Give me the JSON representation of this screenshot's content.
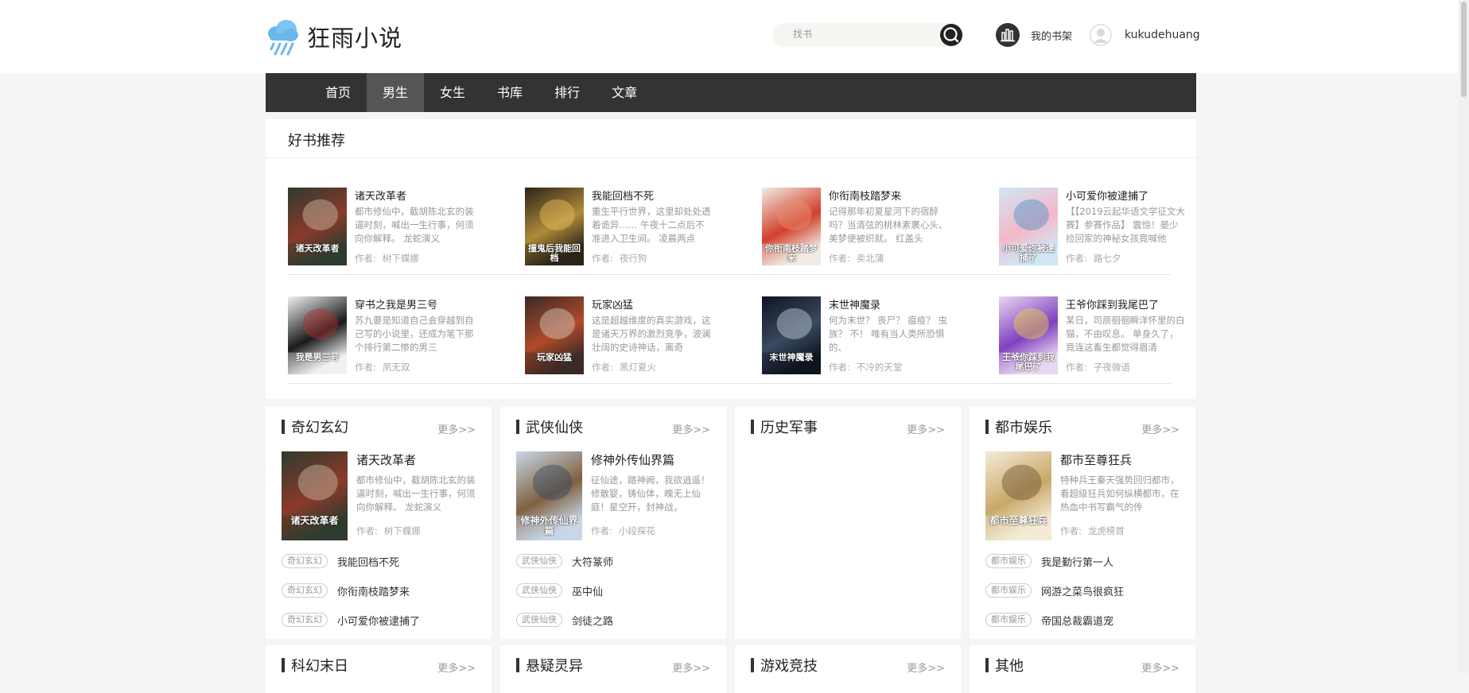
{
  "header": {
    "site_name": "狂雨小说",
    "search_placeholder": "找书",
    "shelf_label": "我的书架",
    "username": "kukudehuang"
  },
  "nav": [
    {
      "label": "首页",
      "active": false
    },
    {
      "label": "男生",
      "active": true
    },
    {
      "label": "女生",
      "active": false
    },
    {
      "label": "书库",
      "active": false
    },
    {
      "label": "排行",
      "active": false
    },
    {
      "label": "文章",
      "active": false
    }
  ],
  "recommend": {
    "title": "好书推荐",
    "author_prefix": "作者:",
    "books": [
      {
        "title": "诸天改革者",
        "desc": "都市修仙中，截胡陈北玄的装逼时刻，喊出一生行事，何须向你解释。 龙蛇演义",
        "author": "树下蝶娜",
        "colors": [
          "#2d3b2f",
          "#8a3a2a",
          "#c9c2a8"
        ]
      },
      {
        "title": "我能回档不死",
        "desc": "重生平行世界，这里却处处透着诡异…… 午夜十二点后不准进入卫生间。 凌晨两点",
        "author": "夜行狗",
        "colors": [
          "#2a2418",
          "#b08a3a",
          "#e8c060"
        ]
      },
      {
        "title": "你衔南枝踏梦来",
        "desc": "记得那年初夏星河下的宿醉吗？当清弦的桃林素裹心头、美梦便被织就。 红盖头",
        "author": "卖北蒲",
        "colors": [
          "#f2ece4",
          "#d0402a",
          "#e89070"
        ]
      },
      {
        "title": "小可爱你被逮捕了",
        "desc": "【【2019云起华语文学征文大赛】参赛作品】 震惊！晏少捡回家的神秘女孩竟喊他",
        "author": "路七夕",
        "colors": [
          "#cfe6f5",
          "#f5b8c8",
          "#4a90c8"
        ]
      },
      {
        "title": "穿书之我是男三号",
        "desc": "苏九要是知道自己会穿越到自己写的小说里，还成为笔下那个排行第二惨的男三",
        "author": "夙无双",
        "colors": [
          "#f2f2f2",
          "#1a1a1a",
          "#b03030"
        ]
      },
      {
        "title": "玩家凶猛",
        "desc": "这是超越维度的真实游戏，这是诸天万界的激烈竞争，波澜壮阔的史诗神话，离奇",
        "author": "黑灯夏火",
        "colors": [
          "#3a2a24",
          "#b04a2a",
          "#d8d0c8"
        ]
      },
      {
        "title": "末世神魔录",
        "desc": "何为末世？ 丧尸？ 瘟疫？ 虫族？ 不！ 唯有当人类所恐惧的、",
        "author": "不冷的天堂",
        "colors": [
          "#0e1420",
          "#3a4a60",
          "#c8d0e0"
        ]
      },
      {
        "title": "王爷你踩到我尾巴了",
        "desc": "某日，司辰徊徊瞬洋怀里的白猫，不由叹息。 单身久了，竟连这畜生都觉得眉清",
        "author": "子夜微语",
        "colors": [
          "#e8d8f0",
          "#8040c0",
          "#f0d040"
        ]
      }
    ]
  },
  "categories": [
    {
      "title": "奇幻玄幻",
      "more": "更多>>",
      "featured": {
        "title": "诸天改革者",
        "desc": "都市修仙中，截胡陈北玄的装逼时刻，喊出一生行事，何须向你解释。 龙蛇演义",
        "author": "树下蝶娜",
        "colors": [
          "#2d3b2f",
          "#8a3a2a",
          "#c9c2a8"
        ]
      },
      "items": [
        {
          "tag": "奇幻玄幻",
          "title": "我能回档不死"
        },
        {
          "tag": "奇幻玄幻",
          "title": "你衔南枝踏梦来"
        },
        {
          "tag": "奇幻玄幻",
          "title": "小可爱你被逮捕了"
        }
      ]
    },
    {
      "title": "武侠仙侠",
      "more": "更多>>",
      "featured": {
        "title": "修神外传仙界篇",
        "desc": "征仙途，踏神阙，我欲逍遥！修散婴，铸仙体，魄无上仙庭！星空开，封神战，",
        "author": "小段探花",
        "colors": [
          "#c8d8e8",
          "#806040",
          "#304860"
        ]
      },
      "items": [
        {
          "tag": "武侠仙侠",
          "title": "大符篆师"
        },
        {
          "tag": "武侠仙侠",
          "title": "巫中仙"
        },
        {
          "tag": "武侠仙侠",
          "title": "剑徒之路"
        }
      ]
    },
    {
      "title": "历史军事",
      "more": "更多>>",
      "featured": null,
      "items": []
    },
    {
      "title": "都市娱乐",
      "more": "更多>>",
      "featured": {
        "title": "都市至尊狂兵",
        "desc": "特种兵王秦天强势回归都市，看超级狂兵如何纵横都市，在热血中书写霸气的传",
        "author": "龙虎榜首",
        "colors": [
          "#f4ecd8",
          "#c8a868",
          "#6a5030"
        ]
      },
      "items": [
        {
          "tag": "都市娱乐",
          "title": "我是勤行第一人"
        },
        {
          "tag": "都市娱乐",
          "title": "网游之菜鸟很疯狂"
        },
        {
          "tag": "都市娱乐",
          "title": "帝国总裁霸道宠"
        }
      ]
    },
    {
      "title": "科幻末日",
      "more": "更多>>",
      "featured": null,
      "items": []
    },
    {
      "title": "悬疑灵异",
      "more": "更多>>",
      "featured": null,
      "items": []
    },
    {
      "title": "游戏竞技",
      "more": "更多>>",
      "featured": null,
      "items": []
    },
    {
      "title": "其他",
      "more": "更多>>",
      "featured": null,
      "items": []
    }
  ],
  "cover_text": {
    "rec_0": "诸天改革者",
    "rec_1": "撞鬼后我能回档",
    "rec_2": "你衔南枝踏梦来",
    "rec_3": "小可爱你被逮捕了",
    "rec_4": "我是男三号",
    "rec_5": "玩家凶猛",
    "rec_6": "末世神魔录",
    "rec_7": "王爷你踩到我尾巴了",
    "cat_0": "诸天改革者",
    "cat_1": "修神外传仙界篇",
    "cat_3": "都市至尊狂兵"
  }
}
